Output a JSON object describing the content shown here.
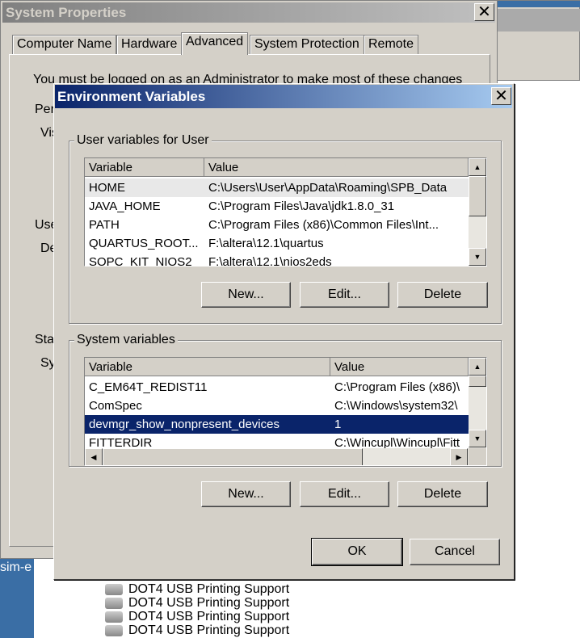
{
  "background": {
    "side_label": "sim-e",
    "devices": [
      "DOT4 USB Printing Support",
      "DOT4 USB Printing Support",
      "DOT4 USB Printing Support",
      "DOT4 USB Printing Support"
    ]
  },
  "system_properties": {
    "title": "System Properties",
    "tabs": [
      "Computer Name",
      "Hardware",
      "Advanced",
      "System Protection",
      "Remote"
    ],
    "active_tab": "Advanced",
    "notice": "You must be logged on as an Administrator to make most of these changes",
    "fragments": [
      "Per",
      "Vis",
      "Use",
      "De",
      "Sta",
      "Sys"
    ]
  },
  "env": {
    "title": "Environment Variables",
    "user_group": "User variables for User",
    "user_headers": [
      "Variable",
      "Value"
    ],
    "user_rows": [
      [
        "HOME",
        "C:\\Users\\User\\AppData\\Roaming\\SPB_Data"
      ],
      [
        "JAVA_HOME",
        "C:\\Program Files\\Java\\jdk1.8.0_31"
      ],
      [
        "PATH",
        "C:\\Program Files (x86)\\Common Files\\Int..."
      ],
      [
        "QUARTUS_ROOT...",
        "F:\\altera\\12.1\\quartus"
      ],
      [
        "SOPC_KIT_NIOS2",
        "F:\\altera\\12.1\\nios2eds"
      ]
    ],
    "system_group": "System variables",
    "system_headers": [
      "Variable",
      "Value"
    ],
    "system_rows": [
      [
        "C_EM64T_REDIST11",
        "C:\\Program Files (x86)\\"
      ],
      [
        "ComSpec",
        "C:\\Windows\\system32\\"
      ],
      [
        "devmgr_show_nonpresent_devices",
        "1"
      ],
      [
        "FITTERDIR",
        "C:\\Wincupl\\Wincupl\\Fitt"
      ]
    ],
    "selected_system_row": 2,
    "new": "New...",
    "edit": "Edit...",
    "delete": "Delete",
    "ok": "OK",
    "cancel": "Cancel"
  },
  "colors": {
    "title_active_start": "#0a246a",
    "title_active_end": "#a6caf0",
    "selection": "#0a246a",
    "face": "#d4d0c8"
  }
}
